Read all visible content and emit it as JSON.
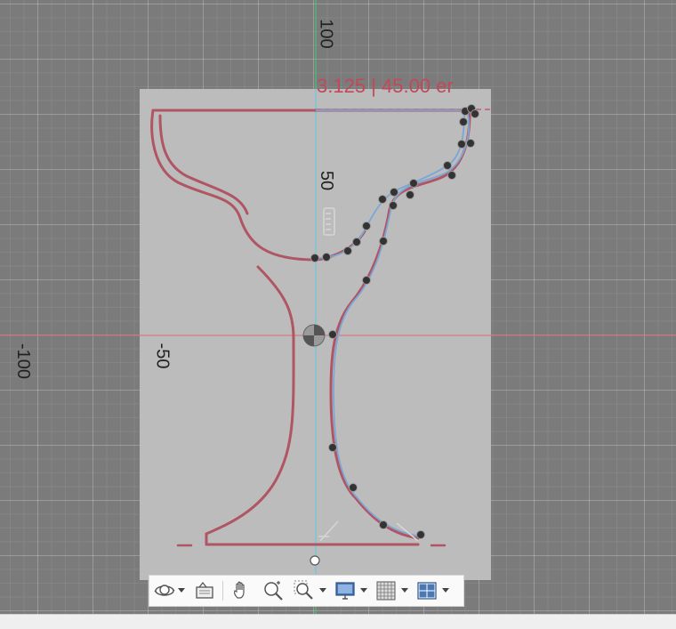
{
  "viewport": {
    "axis_labels": {
      "y_top": "100",
      "y_mid": "50",
      "x_left": "-100",
      "x_mid": "-50"
    },
    "dimension_text": "3.125 | 45.00 er",
    "colors": {
      "grid_bg": "#7b7b7b",
      "canvas": "#bcbcbc",
      "profile": "#b05563",
      "spline": "#7aa7d6",
      "axis_vertical": "#3fd16b",
      "axis_horizontal": "#d86b6b",
      "control_point": "#333333"
    }
  },
  "toolbar": {
    "items": [
      {
        "name": "orbit-icon",
        "has_menu": true
      },
      {
        "name": "look-at-icon",
        "has_menu": false
      },
      {
        "name": "pan-hand-icon",
        "has_menu": false
      },
      {
        "name": "zoom-icon",
        "has_menu": false
      },
      {
        "name": "fit-zoom-window-icon",
        "has_menu": true
      },
      {
        "name": "display-settings-icon",
        "has_menu": true
      },
      {
        "name": "grid-snaps-icon",
        "has_menu": true
      },
      {
        "name": "viewports-icon",
        "has_menu": true
      }
    ]
  }
}
